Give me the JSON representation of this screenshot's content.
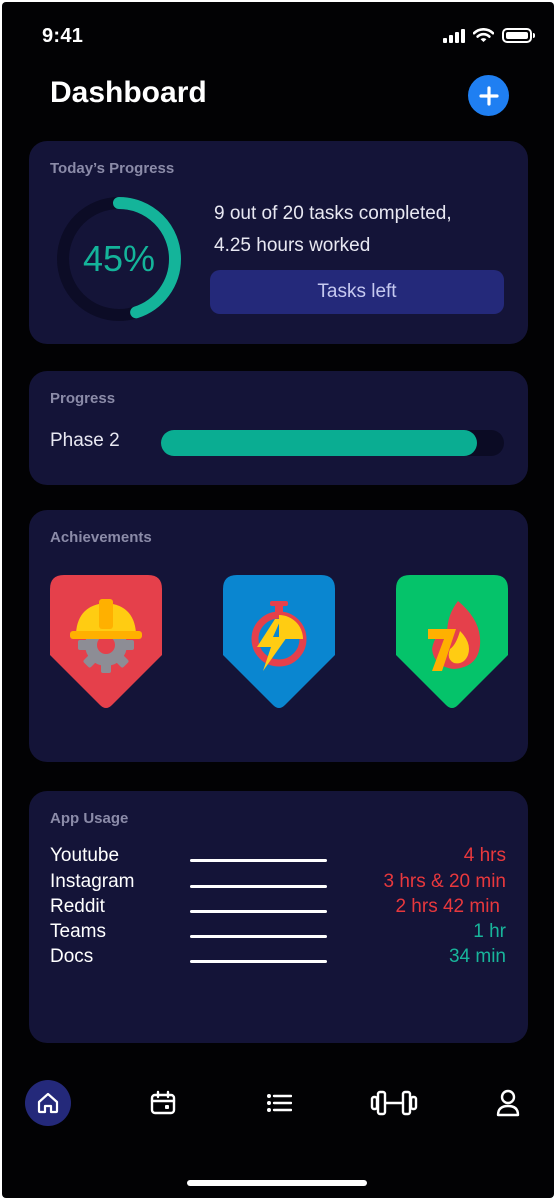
{
  "status_bar": {
    "time": "9:41"
  },
  "header": {
    "title": "Dashboard"
  },
  "todays_progress": {
    "title": "Today’s Progress",
    "percent": 45,
    "percent_label": "45%",
    "summary_line1": "9 out of 20 tasks completed,",
    "summary_line2": "4.25 hours worked",
    "button_label": "Tasks left"
  },
  "phase_progress": {
    "title": "Progress",
    "label": "Phase 2",
    "fraction": 0.92
  },
  "achievements": {
    "title": "Achievements",
    "badges": [
      {
        "name": "builder-badge",
        "color": "#e5404b"
      },
      {
        "name": "speed-badge",
        "color": "#0a86d0"
      },
      {
        "name": "streak-badge",
        "color": "#05c36a"
      }
    ]
  },
  "app_usage": {
    "title": "App Usage",
    "rows": [
      {
        "app": "Youtube",
        "value": "4 hrs",
        "color": "#e8383d"
      },
      {
        "app": "Instagram",
        "value": "3 hrs & 20 min",
        "color": "#e8383d"
      },
      {
        "app": "Reddit",
        "value": "2 hrs 42 min",
        "color": "#e8383d"
      },
      {
        "app": "Teams",
        "value": "1 hr",
        "color": "#18b59b"
      },
      {
        "app": "Docs",
        "value": "34 min",
        "color": "#18b59b"
      }
    ]
  },
  "nav": {
    "items": [
      "home",
      "calendar",
      "list",
      "workout",
      "profile"
    ],
    "active": "home"
  },
  "colors": {
    "accent_teal": "#14b49a",
    "accent_blue": "#1f7ff2",
    "card_bg": "#141438",
    "warning_red": "#e8383d"
  }
}
